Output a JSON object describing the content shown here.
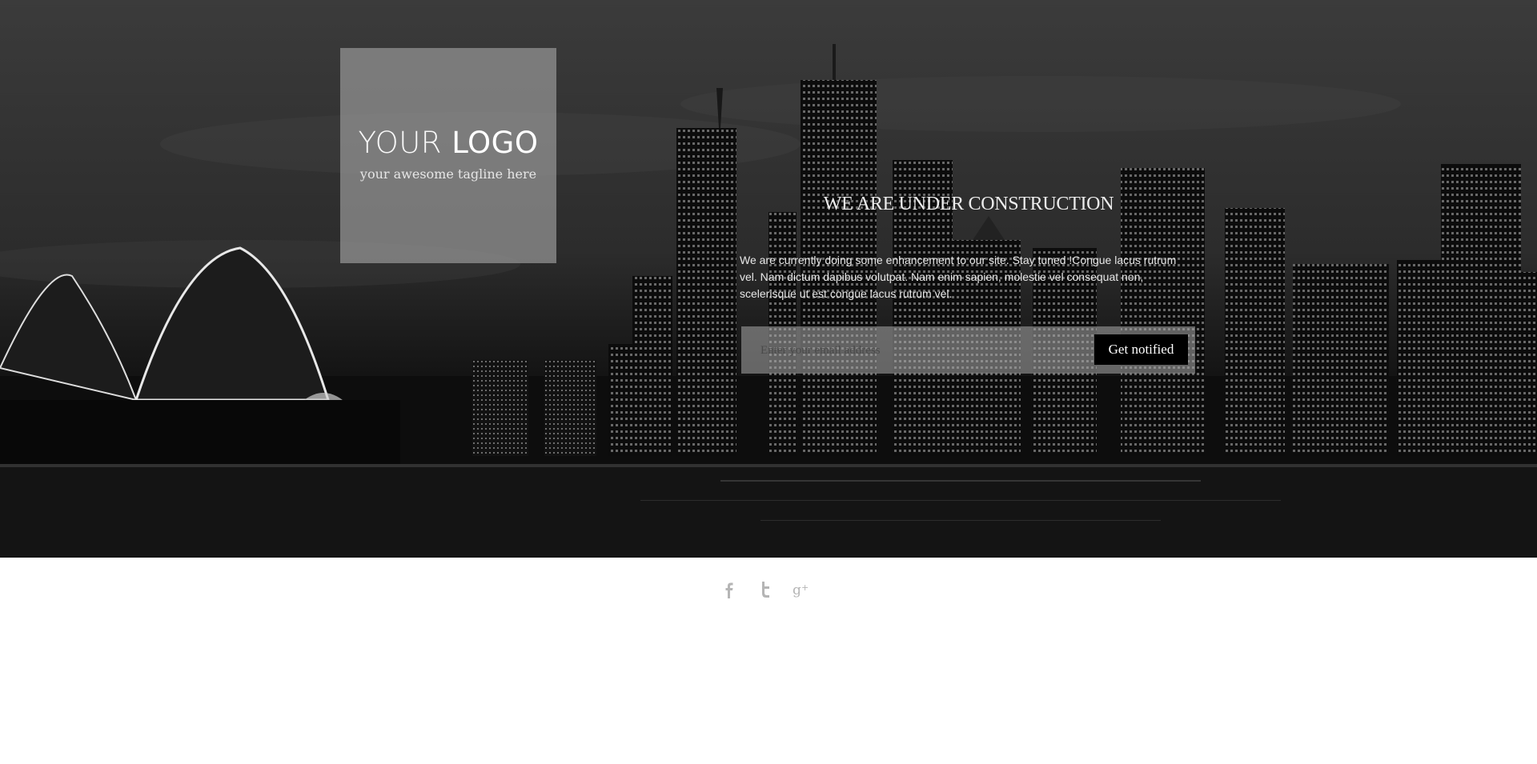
{
  "logo": {
    "word_light": "YOUR",
    "word_bold": "LOGO",
    "tagline": "your awesome tagline here"
  },
  "main": {
    "headline": "WE ARE UNDER CONSTRUCTION",
    "intro": "We are currently doing some enhancement to our site. Stay tuned !Congue lacus rutrum vel. Nam dictum dapibus volutpat. Nam enim sapien, molestie vel consequat non, scelerisque ut est congue lacus rutrum vel."
  },
  "signup": {
    "placeholder": "Enter your email address",
    "button_label": "Get notified"
  },
  "social": {
    "icons": [
      "facebook-icon",
      "twitter-icon",
      "google-plus-icon"
    ],
    "color": "#b5b5b5"
  },
  "colors": {
    "button_bg": "#000000",
    "logo_box_bg": "#8a8a8a"
  }
}
